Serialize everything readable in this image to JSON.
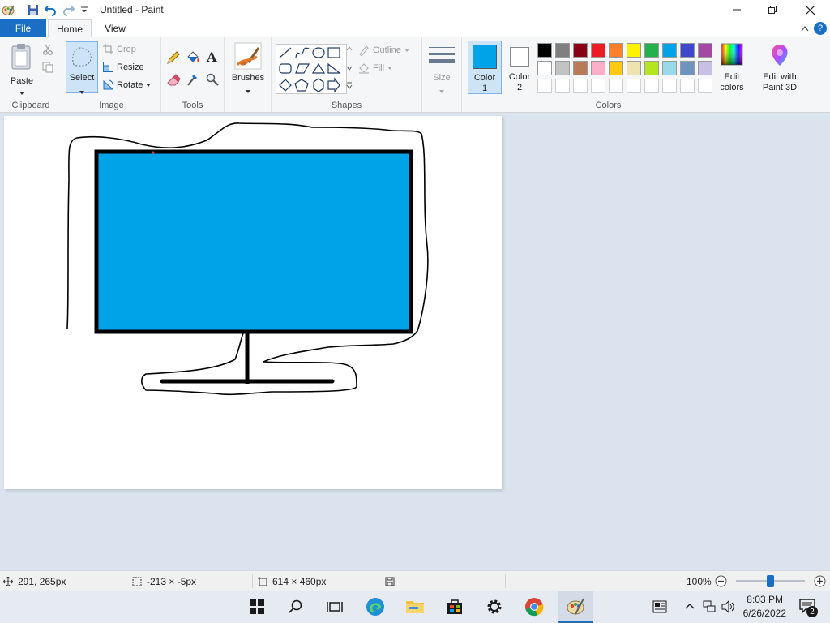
{
  "window": {
    "title": "Untitled - Paint"
  },
  "tabs": {
    "file": "File",
    "home": "Home",
    "view": "View"
  },
  "ribbon": {
    "clipboard": {
      "paste": "Paste",
      "group": "Clipboard"
    },
    "image": {
      "select": "Select",
      "crop": "Crop",
      "resize": "Resize",
      "rotate": "Rotate",
      "group": "Image"
    },
    "tools": {
      "group": "Tools"
    },
    "brushes": {
      "label": "Brushes"
    },
    "shapes": {
      "outline": "Outline",
      "fill": "Fill",
      "group": "Shapes"
    },
    "size": {
      "label": "Size"
    },
    "colors": {
      "color1": "Color",
      "color1_num": "1",
      "color2": "Color",
      "color2_num": "2",
      "edit1": "Edit",
      "edit2": "colors",
      "group": "Colors",
      "color1_value": "#00a2e8",
      "color2_value": "#ffffff",
      "palette_row1": [
        "#000000",
        "#7f7f7f",
        "#880015",
        "#ed1c24",
        "#ff7f27",
        "#fff200",
        "#22b14c",
        "#00a2e8",
        "#3f48cc",
        "#a349a4"
      ],
      "palette_row2": [
        "#ffffff",
        "#c3c3c3",
        "#b97a57",
        "#ffaec9",
        "#ffc90e",
        "#efe4b0",
        "#b5e61d",
        "#99d9ea",
        "#7092be",
        "#c8bfe7"
      ]
    },
    "paint3d": {
      "line1": "Edit with",
      "line2": "Paint 3D"
    }
  },
  "status": {
    "cursor": "291, 265px",
    "selection": "-213 × -5px",
    "canvas_size": "614 × 460px",
    "zoom": "100%"
  },
  "taskbar": {
    "time": "8:03 PM",
    "date": "6/26/2022",
    "notif_count": "2"
  }
}
